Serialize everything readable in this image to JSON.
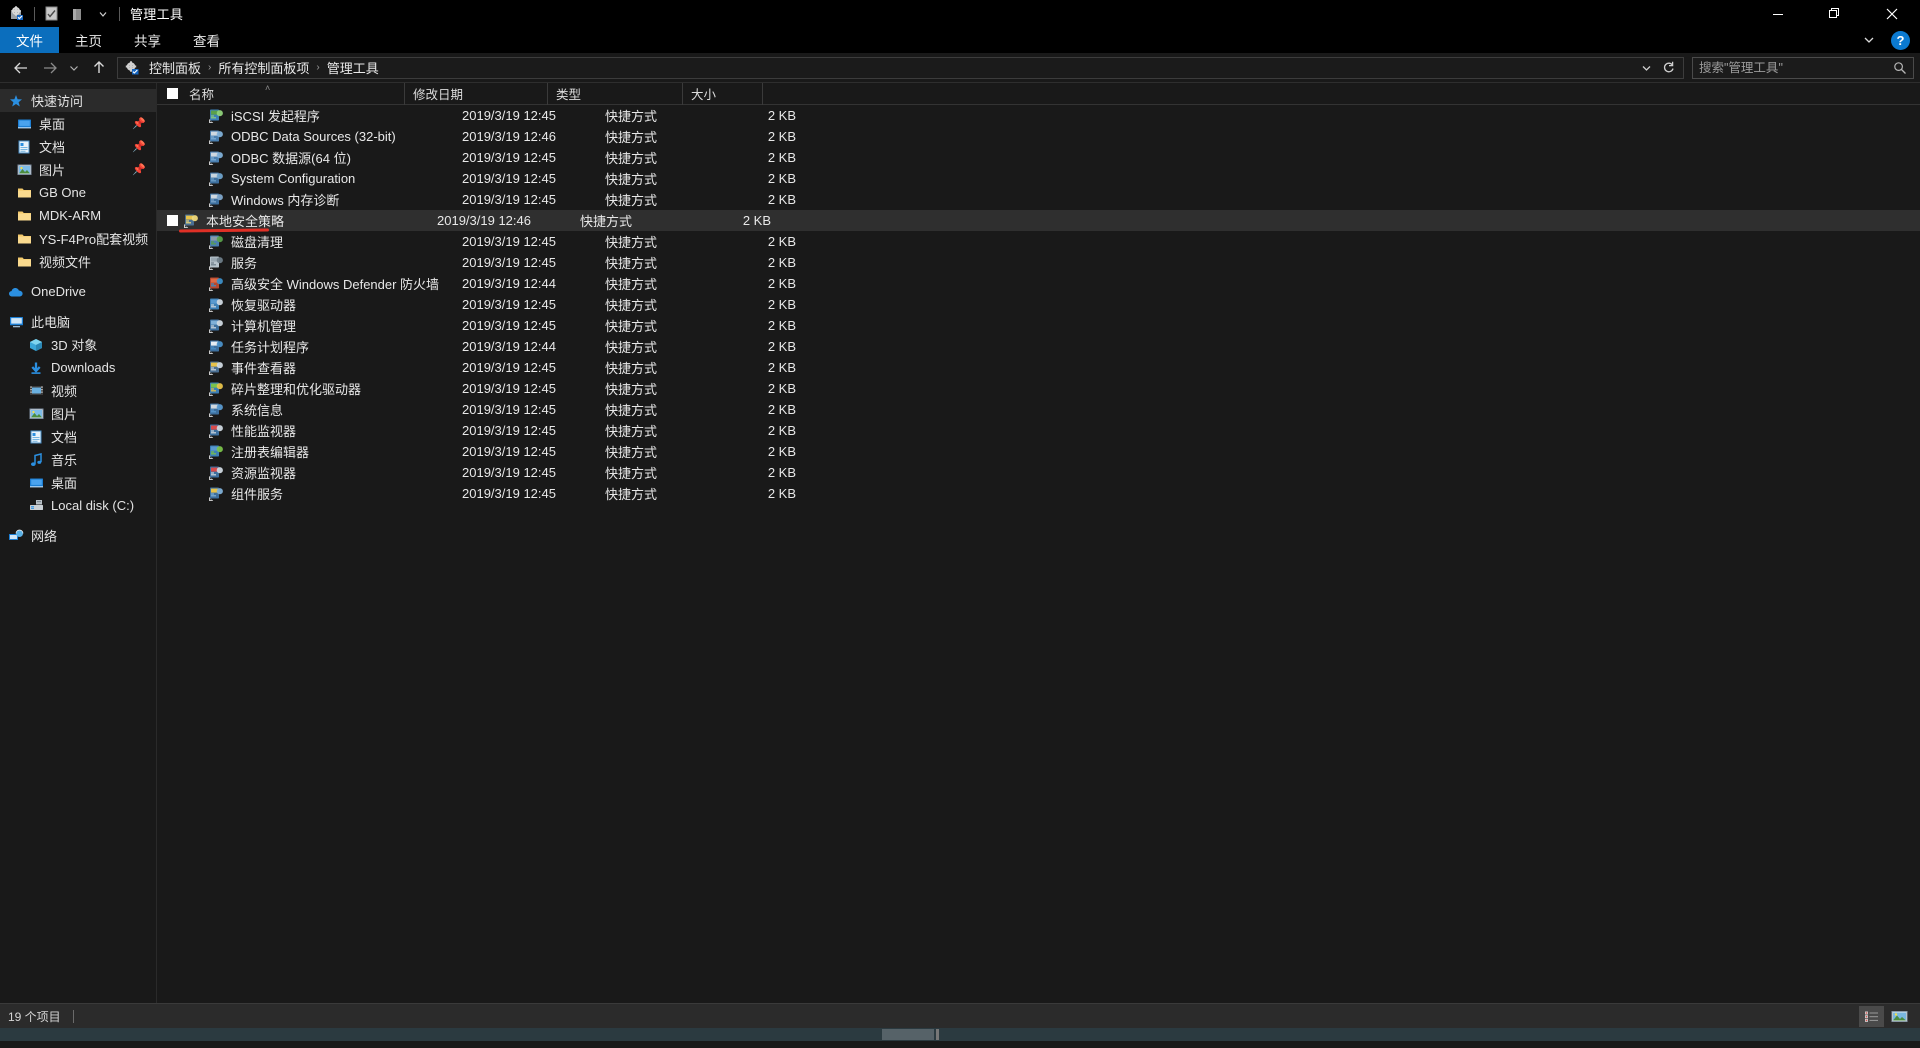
{
  "window": {
    "title": "管理工具",
    "quick_access_toolbar": [
      {
        "name": "properties-icon",
        "label": "属性"
      },
      {
        "name": "new-folder-icon",
        "label": "新建文件夹"
      },
      {
        "name": "customize-qat-chevron-icon",
        "label": "自定义快速访问工具栏"
      }
    ],
    "controls": {
      "minimize": "—",
      "restore": "❐",
      "close": "✕",
      "ribbon_chevron": "⌄",
      "help": "?"
    }
  },
  "ribbon": {
    "tabs": [
      {
        "label": "文件",
        "active": true
      },
      {
        "label": "主页",
        "active": false
      },
      {
        "label": "共享",
        "active": false
      },
      {
        "label": "查看",
        "active": false
      }
    ]
  },
  "addressbar": {
    "back": "←",
    "forward": "→",
    "recent": "⌄",
    "up": "↑",
    "breadcrumbs": [
      "控制面板",
      "所有控制面板项",
      "管理工具"
    ],
    "separator": "›",
    "dropdown": "⌄",
    "refresh": "↻"
  },
  "search": {
    "placeholder": "搜索\"管理工具\"",
    "value": "",
    "icon": "search-icon"
  },
  "navpane": {
    "groups": [
      {
        "header": {
          "label": "快速访问",
          "icon": "star-icon",
          "selected": true
        },
        "items": [
          {
            "label": "桌面",
            "icon": "desktop-icon",
            "pinned": true
          },
          {
            "label": "文档",
            "icon": "documents-icon",
            "pinned": true
          },
          {
            "label": "图片",
            "icon": "pictures-icon",
            "pinned": true
          },
          {
            "label": "GB One",
            "icon": "folder-icon",
            "pinned": false
          },
          {
            "label": "MDK-ARM",
            "icon": "folder-icon",
            "pinned": false
          },
          {
            "label": "YS-F4Pro配套视频",
            "icon": "folder-icon",
            "pinned": false
          },
          {
            "label": "视频文件",
            "icon": "folder-icon",
            "pinned": false
          }
        ]
      },
      {
        "header": {
          "label": "OneDrive",
          "icon": "onedrive-icon",
          "selected": false
        },
        "items": []
      },
      {
        "header": {
          "label": "此电脑",
          "icon": "this-pc-icon",
          "selected": false
        },
        "items": [
          {
            "label": "3D 对象",
            "icon": "3d-objects-icon",
            "pinned": false
          },
          {
            "label": "Downloads",
            "icon": "downloads-icon",
            "pinned": false
          },
          {
            "label": "视频",
            "icon": "videos-icon",
            "pinned": false
          },
          {
            "label": "图片",
            "icon": "pictures-icon",
            "pinned": false
          },
          {
            "label": "文档",
            "icon": "documents-icon",
            "pinned": false
          },
          {
            "label": "音乐",
            "icon": "music-icon",
            "pinned": false
          },
          {
            "label": "桌面",
            "icon": "desktop-icon",
            "pinned": false
          },
          {
            "label": "Local disk (C:)",
            "icon": "disk-icon",
            "pinned": false
          }
        ]
      },
      {
        "header": {
          "label": "网络",
          "icon": "network-icon",
          "selected": false
        },
        "items": []
      }
    ]
  },
  "filelist": {
    "columns": [
      {
        "label": "名称",
        "key": "name"
      },
      {
        "label": "修改日期",
        "key": "date"
      },
      {
        "label": "类型",
        "key": "type"
      },
      {
        "label": "大小",
        "key": "size"
      }
    ],
    "sort_indicator": "˄",
    "rows": [
      {
        "name": "iSCSI 发起程序",
        "date": "2019/3/19 12:45",
        "type": "快捷方式",
        "size": "2 KB",
        "icon": "shortcut-iscsi-icon",
        "selected": false
      },
      {
        "name": "ODBC Data Sources (32-bit)",
        "date": "2019/3/19 12:46",
        "type": "快捷方式",
        "size": "2 KB",
        "icon": "shortcut-odbc-icon",
        "selected": false
      },
      {
        "name": "ODBC 数据源(64 位)",
        "date": "2019/3/19 12:45",
        "type": "快捷方式",
        "size": "2 KB",
        "icon": "shortcut-odbc-icon",
        "selected": false
      },
      {
        "name": "System Configuration",
        "date": "2019/3/19 12:45",
        "type": "快捷方式",
        "size": "2 KB",
        "icon": "shortcut-msconfig-icon",
        "selected": false
      },
      {
        "name": "Windows 内存诊断",
        "date": "2019/3/19 12:45",
        "type": "快捷方式",
        "size": "2 KB",
        "icon": "shortcut-memory-icon",
        "selected": false
      },
      {
        "name": "本地安全策略",
        "date": "2019/3/19 12:46",
        "type": "快捷方式",
        "size": "2 KB",
        "icon": "shortcut-secpol-icon",
        "selected": true
      },
      {
        "name": "磁盘清理",
        "date": "2019/3/19 12:45",
        "type": "快捷方式",
        "size": "2 KB",
        "icon": "shortcut-cleanmgr-icon",
        "selected": false
      },
      {
        "name": "服务",
        "date": "2019/3/19 12:45",
        "type": "快捷方式",
        "size": "2 KB",
        "icon": "shortcut-services-icon",
        "selected": false
      },
      {
        "name": "高级安全 Windows Defender 防火墙",
        "date": "2019/3/19 12:44",
        "type": "快捷方式",
        "size": "2 KB",
        "icon": "shortcut-firewall-icon",
        "selected": false
      },
      {
        "name": "恢复驱动器",
        "date": "2019/3/19 12:45",
        "type": "快捷方式",
        "size": "2 KB",
        "icon": "shortcut-recovery-icon",
        "selected": false
      },
      {
        "name": "计算机管理",
        "date": "2019/3/19 12:45",
        "type": "快捷方式",
        "size": "2 KB",
        "icon": "shortcut-compmgmt-icon",
        "selected": false
      },
      {
        "name": "任务计划程序",
        "date": "2019/3/19 12:44",
        "type": "快捷方式",
        "size": "2 KB",
        "icon": "shortcut-taskschd-icon",
        "selected": false
      },
      {
        "name": "事件查看器",
        "date": "2019/3/19 12:45",
        "type": "快捷方式",
        "size": "2 KB",
        "icon": "shortcut-eventvwr-icon",
        "selected": false
      },
      {
        "name": "碎片整理和优化驱动器",
        "date": "2019/3/19 12:45",
        "type": "快捷方式",
        "size": "2 KB",
        "icon": "shortcut-dfrgui-icon",
        "selected": false
      },
      {
        "name": "系统信息",
        "date": "2019/3/19 12:45",
        "type": "快捷方式",
        "size": "2 KB",
        "icon": "shortcut-msinfo-icon",
        "selected": false
      },
      {
        "name": "性能监视器",
        "date": "2019/3/19 12:45",
        "type": "快捷方式",
        "size": "2 KB",
        "icon": "shortcut-perfmon-icon",
        "selected": false
      },
      {
        "name": "注册表编辑器",
        "date": "2019/3/19 12:45",
        "type": "快捷方式",
        "size": "2 KB",
        "icon": "shortcut-regedit-icon",
        "selected": false
      },
      {
        "name": "资源监视器",
        "date": "2019/3/19 12:45",
        "type": "快捷方式",
        "size": "2 KB",
        "icon": "shortcut-resmon-icon",
        "selected": false
      },
      {
        "name": "组件服务",
        "date": "2019/3/19 12:45",
        "type": "快捷方式",
        "size": "2 KB",
        "icon": "shortcut-dcomcnfg-icon",
        "selected": false
      }
    ]
  },
  "annotation": {
    "color": "#e03026",
    "target_row": "本地安全策略"
  },
  "statusbar": {
    "item_count": "19 个项目",
    "views": [
      {
        "name": "details-view-button",
        "active": true
      },
      {
        "name": "large-icons-view-button",
        "active": false
      }
    ]
  },
  "colors": {
    "accent": "#0b6ebd",
    "background": "#191919",
    "titlebar": "#000000",
    "selected_row": "#2f2f2f",
    "statusbar": "#2b2b2b",
    "annotation_red": "#e03026"
  }
}
